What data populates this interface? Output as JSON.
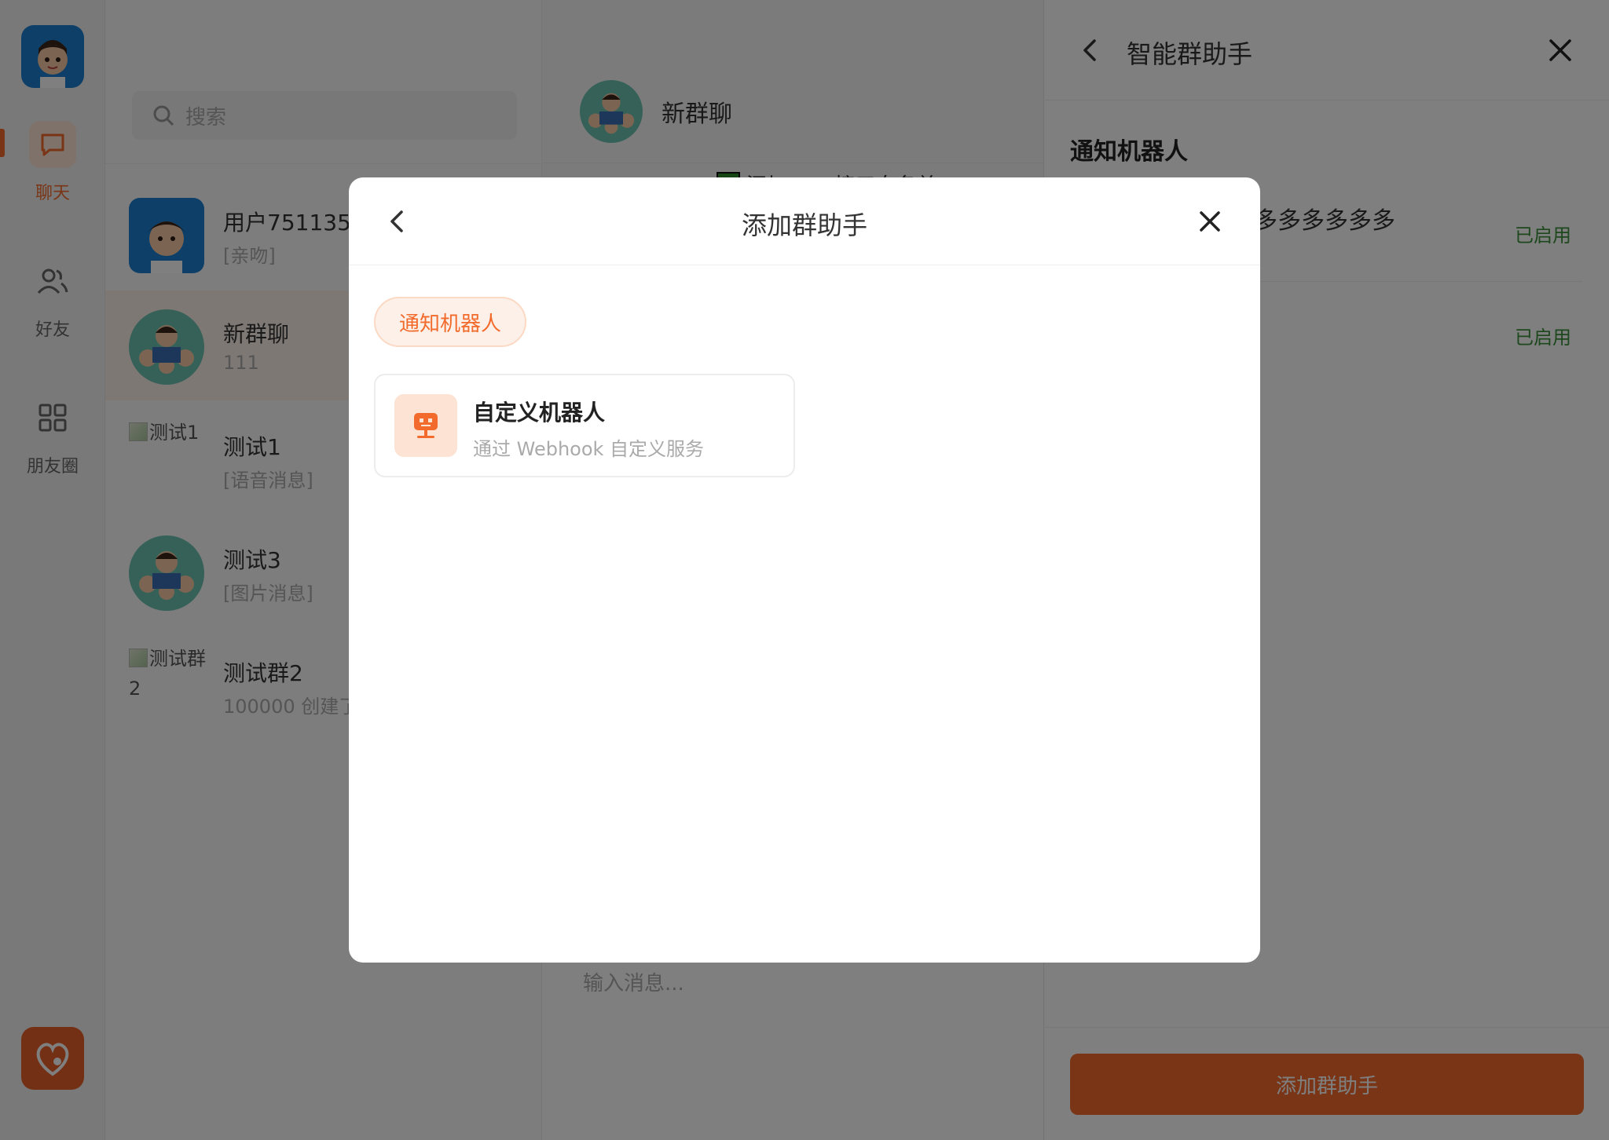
{
  "nav": {
    "items": [
      {
        "label": "聊天",
        "icon": "chat-bubble-icon",
        "active": true
      },
      {
        "label": "好友",
        "icon": "users-icon",
        "active": false
      },
      {
        "label": "朋友圈",
        "icon": "grid-icon",
        "active": false
      }
    ]
  },
  "search": {
    "placeholder": "搜索"
  },
  "conversations": [
    {
      "name": "用户751135",
      "preview": "[亲吻]"
    },
    {
      "name": "新群聊",
      "preview": "111"
    },
    {
      "name": "测试1",
      "preview": "[语音消息]",
      "img_alt": "测试1"
    },
    {
      "name": "测试3",
      "preview": "[图片消息]"
    },
    {
      "name": "测试群2",
      "preview": "100000 创建了",
      "img_alt": "测试群2"
    }
  ],
  "chat": {
    "title": "新群聊",
    "notice": "添加 Bot 接口白名单",
    "input_placeholder": "输入消息..."
  },
  "drawer": {
    "title": "智能群助手",
    "section": "通知机器人",
    "row_text": "多多多多多多",
    "status_1": "已启用",
    "status_2": "已启用",
    "add_button": "添加群助手"
  },
  "modal": {
    "title": "添加群助手",
    "chip": "通知机器人",
    "bot_name": "自定义机器人",
    "bot_desc": "通过 Webhook 自定义服务"
  },
  "colors": {
    "accent": "#f26b2c",
    "enabled": "#3a8f3a"
  }
}
